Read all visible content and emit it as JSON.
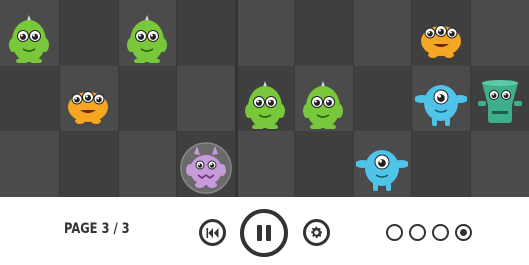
{
  "game": {
    "grid": {
      "rows": 3,
      "columns": 9,
      "playhead_column": 4
    },
    "monsters": [
      {
        "id": "green-1",
        "kind": "green-horn",
        "row": 0,
        "col": 0
      },
      {
        "id": "green-2",
        "kind": "green-horn",
        "row": 0,
        "col": 2
      },
      {
        "id": "orange-1",
        "kind": "orange-fuzzy",
        "row": 0,
        "col": 7
      },
      {
        "id": "orange-2",
        "kind": "orange-fuzzy",
        "row": 1,
        "col": 1
      },
      {
        "id": "green-3",
        "kind": "green-horn",
        "row": 1,
        "col": 4
      },
      {
        "id": "green-4",
        "kind": "green-horn",
        "row": 1,
        "col": 5
      },
      {
        "id": "blue-1",
        "kind": "blue-cyclops",
        "row": 1,
        "col": 7
      },
      {
        "id": "teal-1",
        "kind": "teal-robot",
        "row": 1,
        "col": 8
      },
      {
        "id": "pink-1",
        "kind": "pink-furry-selected",
        "row": 2,
        "col": 3
      },
      {
        "id": "blue-2",
        "kind": "blue-cyclops",
        "row": 2,
        "col": 6
      }
    ],
    "colors": {
      "green": "#79c73a",
      "orange": "#f5a623",
      "blue": "#4fc3e8",
      "pink": "#c79ad9",
      "teal": "#3fae8c",
      "grid_light": "#4b4b4b",
      "grid_dark": "#3f3f3f"
    }
  },
  "controls": {
    "page_label": "PAGE 3 / 3",
    "rewind_icon": "rewind-icon",
    "pause_icon": "pause-icon",
    "settings_icon": "gear-icon",
    "page_dots": {
      "count": 4,
      "active_index": 3
    }
  }
}
